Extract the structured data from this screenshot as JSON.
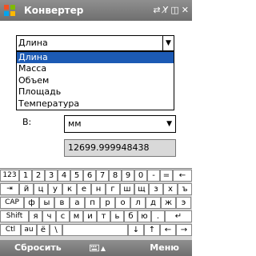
{
  "titlebar": {
    "title": "Конвертер",
    "icons": [
      "start-logo-icon",
      "sync-icon",
      "signal-off-icon",
      "vibrate-icon",
      "close-icon"
    ]
  },
  "converter": {
    "category_combo": {
      "value": "Длина",
      "options": [
        "Длина",
        "Масса",
        "Объем",
        "Площадь",
        "Температура"
      ]
    },
    "to_label": "В:",
    "unit_select_value": "мм",
    "result_value": "12699.999948438"
  },
  "keyboard": {
    "row1": [
      "123",
      "1",
      "2",
      "3",
      "4",
      "5",
      "6",
      "7",
      "8",
      "9",
      "0",
      "-",
      "=",
      "←"
    ],
    "row2": [
      "⇥",
      "й",
      "ц",
      "у",
      "к",
      "е",
      "н",
      "г",
      "ш",
      "щ",
      "з",
      "х",
      "ъ"
    ],
    "row3": [
      "CAP",
      "ф",
      "ы",
      "в",
      "а",
      "п",
      "р",
      "о",
      "л",
      "д",
      "ж",
      "э"
    ],
    "row4": [
      "Shift",
      "я",
      "ч",
      "с",
      "м",
      "и",
      "т",
      "ь",
      "б",
      "ю",
      ".",
      "↵"
    ],
    "row5": [
      "Ctl",
      "au",
      "ё",
      "\\",
      "",
      "↓",
      "↑",
      "←",
      "→"
    ]
  },
  "menubar": {
    "left": "Сбросить",
    "right": "Меню"
  }
}
